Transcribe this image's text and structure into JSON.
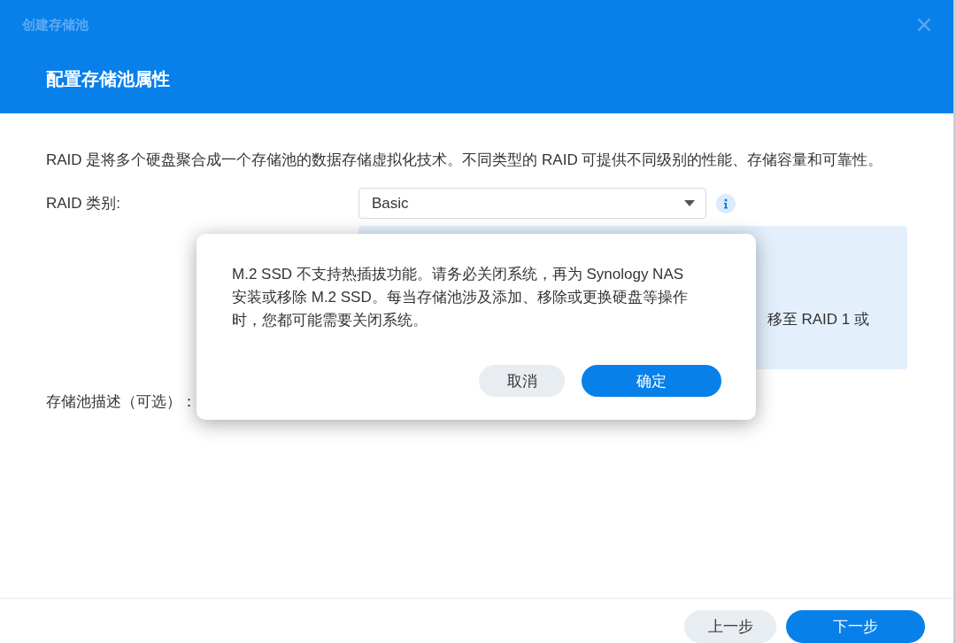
{
  "window": {
    "title": "创建存储池"
  },
  "header": {
    "heading": "配置存储池属性"
  },
  "description": "RAID 是将多个硬盘聚合成一个存储池的数据存储虚拟化技术。不同类型的 RAID 可提供不同级别的性能、存储容量和可靠性。",
  "form": {
    "raid_type": {
      "label": "RAID 类别:",
      "value": "Basic"
    },
    "info_panel": {
      "text": "移至 RAID 1 或"
    },
    "pool_description": {
      "label": "存储池描述（可选）："
    }
  },
  "dialog": {
    "message": "M.2 SSD 不支持热插拔功能。请务必关闭系统，再为 Synology NAS 安装或移除 M.2 SSD。每当存储池涉及添加、移除或更换硬盘等操作时，您都可能需要关闭系统。",
    "buttons": [
      {
        "label": "取消",
        "kind": "secondary"
      },
      {
        "label": "确定",
        "kind": "primary"
      }
    ]
  },
  "footer": {
    "buttons": [
      {
        "label": "上一步",
        "kind": "secondary"
      },
      {
        "label": "下一步",
        "kind": "primary"
      }
    ]
  }
}
